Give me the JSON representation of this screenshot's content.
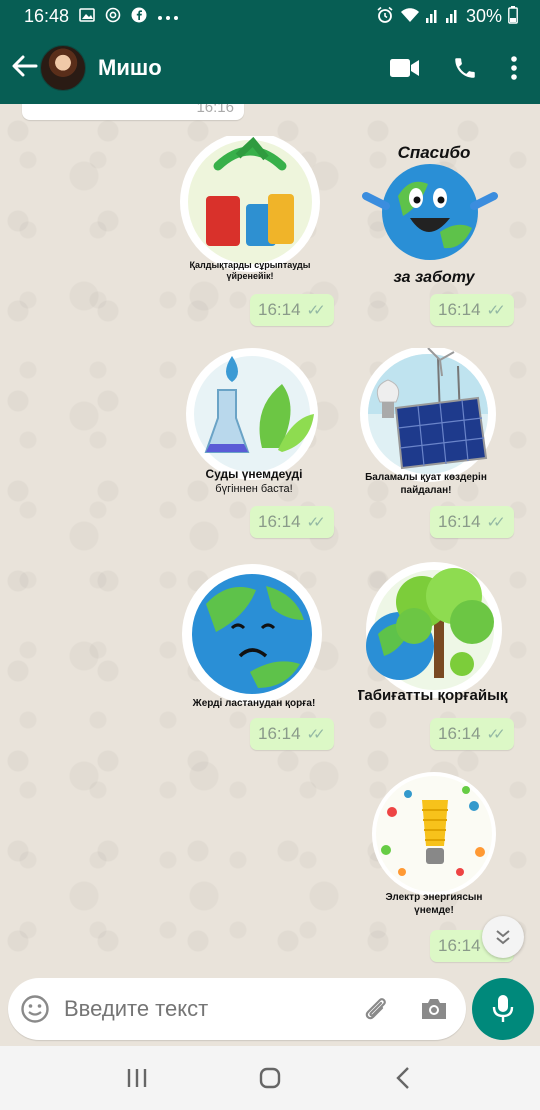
{
  "status_bar": {
    "time": "16:48",
    "battery": "30%",
    "left_icons": [
      "image-icon",
      "at-icon",
      "facebook-icon",
      "more-dots-icon"
    ],
    "right_icons": [
      "alarm-icon",
      "wifi-icon",
      "signal-icon",
      "signal-icon",
      "battery-icon"
    ]
  },
  "header": {
    "contact_name": "Мишо",
    "accent_color": "#075e54"
  },
  "chat": {
    "previous_time": "16:16",
    "stickers": [
      {
        "name": "sticker-recycling",
        "caption": "Қалдықтарды сұрыптауды үйренейік!",
        "time": "16:14"
      },
      {
        "name": "sticker-thanks-earth",
        "caption_top": "Спасибо",
        "caption": "за заботу",
        "time": "16:14"
      },
      {
        "name": "sticker-save-water",
        "caption_top": "Суды үнемдеуді",
        "caption": "бүгіннен баста!",
        "time": "16:14"
      },
      {
        "name": "sticker-alternative-energy",
        "caption": "Баламалы қуат көздерін пайдалан!",
        "time": "16:14"
      },
      {
        "name": "sticker-sad-earth",
        "caption": "Жерді ластанудан қорға!",
        "time": "16:14"
      },
      {
        "name": "sticker-protect-nature",
        "caption": "Табиғатты қорғайық!",
        "time": "16:14"
      },
      {
        "name": "sticker-save-electricity",
        "caption": "Электр энергиясын үнемде!",
        "time": "16:14"
      }
    ],
    "bubble_color": "#dcf8c6"
  },
  "input": {
    "placeholder": "Введите текст"
  },
  "colors": {
    "mic_button": "#00897b"
  }
}
